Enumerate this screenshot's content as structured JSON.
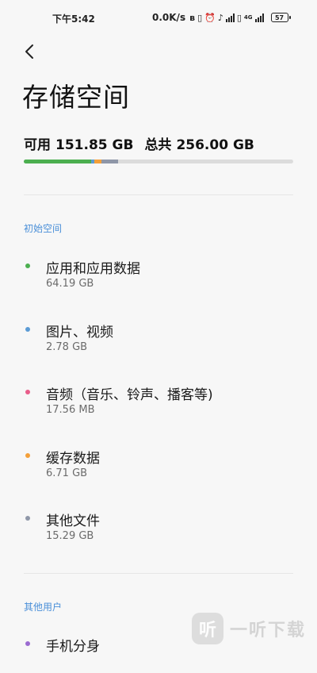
{
  "status_bar": {
    "time": "下午5:42",
    "net_speed": "0.0K/s",
    "battery": "57",
    "network_badge": "4G"
  },
  "header": {
    "back_icon": "chevron-left-icon",
    "title": "存储空间"
  },
  "summary": {
    "available_label": "可用",
    "available_value": "151.85 GB",
    "total_label": "总共",
    "total_value": "256.00 GB"
  },
  "usage_bar": {
    "used_fraction": 0.407,
    "segments": [
      {
        "name": "应用和应用数据",
        "fraction": 0.251,
        "color": "#4caf50"
      },
      {
        "name": "图片、视频",
        "fraction": 0.011,
        "color": "#5b9bd5"
      },
      {
        "name": "音频",
        "fraction": 0.001,
        "color": "#e85d8a"
      },
      {
        "name": "缓存数据",
        "fraction": 0.026,
        "color": "#f4a03a"
      },
      {
        "name": "其他文件",
        "fraction": 0.06,
        "color": "#8f97a8"
      }
    ],
    "track_color": "#dcdcdc"
  },
  "sections": [
    {
      "label": "初始空间",
      "items": [
        {
          "label": "应用和应用数据",
          "size": "64.19 GB",
          "color": "#4caf50"
        },
        {
          "label": "图片、视频",
          "size": "2.78 GB",
          "color": "#5b9bd5"
        },
        {
          "label": "音频（音乐、铃声、播客等)",
          "size": "17.56 MB",
          "color": "#e85d8a"
        },
        {
          "label": "缓存数据",
          "size": "6.71 GB",
          "color": "#f4a03a"
        },
        {
          "label": "其他文件",
          "size": "15.29 GB",
          "color": "#8f97a8"
        }
      ]
    },
    {
      "label": "其他用户",
      "items": [
        {
          "label": "手机分身",
          "size": "",
          "color": "#9b6bd1"
        }
      ]
    }
  ],
  "watermark": {
    "logo_text": "听",
    "text": "一听下载"
  }
}
